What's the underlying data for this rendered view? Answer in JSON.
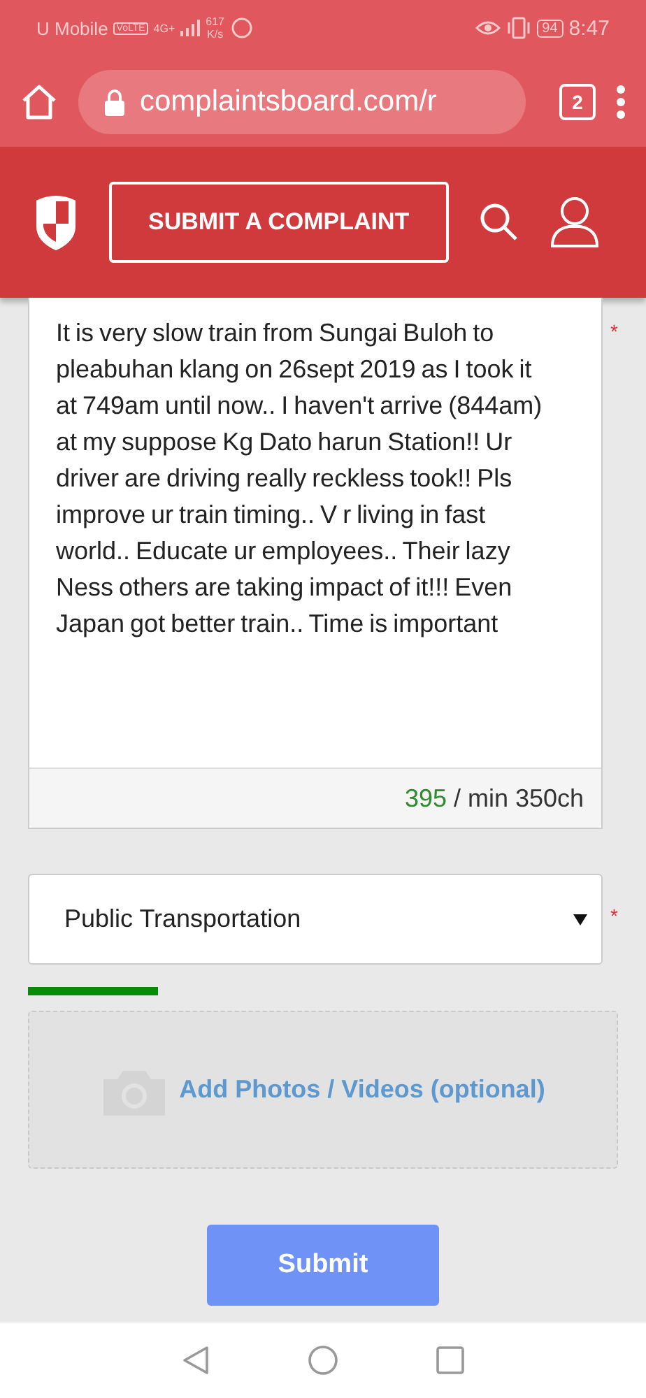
{
  "status_bar": {
    "carrier": "U Mobile",
    "volte": "VoLTE",
    "network": "4G+",
    "speed": "617",
    "speed_unit": "K/s",
    "battery": "94",
    "time": "8:47"
  },
  "browser": {
    "url": "complaintsboard.com/r",
    "tab_count": "2"
  },
  "header": {
    "cta": "SUBMIT A COMPLAINT"
  },
  "form": {
    "complaint_text": "It is very slow train from Sungai Buloh to pleabuhan klang on 26sept 2019 as I took it at 749am until now.. I haven't arrive (844am) at my suppose Kg Dato harun Station!! Ur driver are driving really reckless took!! Pls improve ur train timing.. V r living in fast world.. Educate ur employees.. Their lazy Ness others are taking impact of it!!!  Even Japan got better train.. Time is important",
    "required_mark": "*",
    "char_count": "395",
    "char_min": "/ min 350ch",
    "category": "Public Transportation",
    "category_required_mark": "*",
    "upload_label": "Add Photos / Videos (optional)",
    "submit": "Submit"
  }
}
